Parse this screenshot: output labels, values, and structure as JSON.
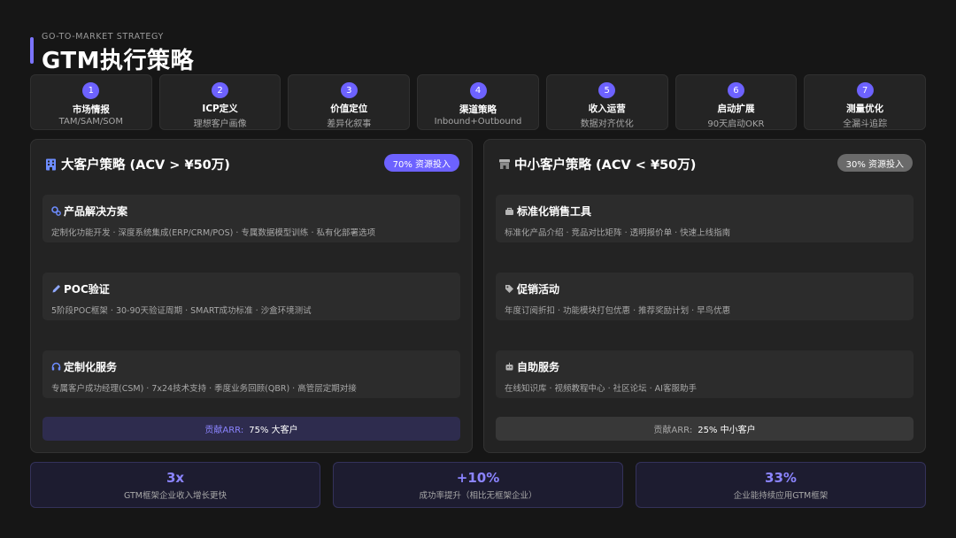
{
  "header": {
    "eyebrow": "GO-TO-MARKET STRATEGY",
    "title": "GTM执行策略"
  },
  "steps": [
    {
      "num": "1",
      "name": "市场情报",
      "sub": "TAM/SAM/SOM"
    },
    {
      "num": "2",
      "name": "ICP定义",
      "sub": "理想客户画像"
    },
    {
      "num": "3",
      "name": "价值定位",
      "sub": "差异化叙事"
    },
    {
      "num": "4",
      "name": "渠道策略",
      "sub": "Inbound+Outbound"
    },
    {
      "num": "5",
      "name": "收入运营",
      "sub": "数据对齐优化"
    },
    {
      "num": "6",
      "name": "启动扩展",
      "sub": "90天启动OKR"
    },
    {
      "num": "7",
      "name": "测量优化",
      "sub": "全漏斗追踪"
    }
  ],
  "enterprise": {
    "icon": "building-icon",
    "title": "大客户策略 (ACV > ¥50万)",
    "badge": "70% 资源投入",
    "accent": "#6d62ff",
    "cards": [
      {
        "icon": "gears-icon",
        "title": "产品解决方案",
        "desc": "定制化功能开发 · 深度系统集成(ERP/CRM/POS) · 专属数据模型训练 · 私有化部署选项"
      },
      {
        "icon": "pencil-icon",
        "title": "POC验证",
        "desc": "5阶段POC框架 · 30-90天验证周期 · SMART成功标准 · 沙盒环境测试"
      },
      {
        "icon": "headset-icon",
        "title": "定制化服务",
        "desc": "专属客户成功经理(CSM) · 7x24技术支持 · 季度业务回顾(QBR) · 高管层定期对接"
      }
    ],
    "contrib_label": "贡献ARR:",
    "contrib_value": "75% 大客户"
  },
  "smb": {
    "icon": "store-icon",
    "title": "中小客户策略 (ACV < ¥50万)",
    "badge": "30% 资源投入",
    "cards": [
      {
        "icon": "toolbox-icon",
        "title": "标准化销售工具",
        "desc": "标准化产品介绍 · 竞品对比矩阵 · 透明报价单 · 快速上线指南"
      },
      {
        "icon": "tag-icon",
        "title": "促销活动",
        "desc": "年度订阅折扣 · 功能模块打包优惠 · 推荐奖励计划 · 早鸟优惠"
      },
      {
        "icon": "robot-icon",
        "title": "自助服务",
        "desc": "在线知识库 · 视频教程中心 · 社区论坛 · AI客服助手"
      }
    ],
    "contrib_label": "贡献ARR:",
    "contrib_value": "25% 中小客户"
  },
  "stats": [
    {
      "big": "3x",
      "small": "GTM框架企业收入增长更快"
    },
    {
      "big": "+10%",
      "small": "成功率提升（相比无框架企业）"
    },
    {
      "big": "33%",
      "small": "企业能持续应用GTM框架"
    }
  ]
}
